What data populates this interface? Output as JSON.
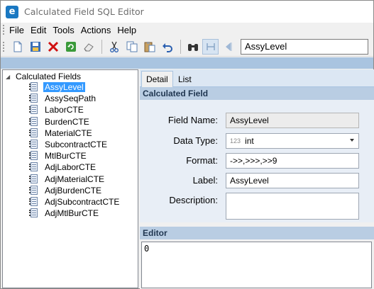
{
  "window": {
    "title": "Calculated Field SQL Editor",
    "app_icon_letter": "e"
  },
  "menu": [
    "File",
    "Edit",
    "Tools",
    "Actions",
    "Help"
  ],
  "toolbar": {
    "buttons": [
      "new-document-icon",
      "save-icon",
      "delete-icon",
      "refresh-icon",
      "eraser-icon",
      "cut-icon",
      "copy-icon",
      "paste-icon",
      "undo-icon",
      "binoculars-icon",
      "find-next-icon",
      "navigate-back-icon"
    ],
    "selected_field": "AssyLevel"
  },
  "tree": {
    "root_label": "Calculated Fields",
    "items": [
      "AssyLevel",
      "AssySeqPath",
      "LaborCTE",
      "BurdenCTE",
      "MaterialCTE",
      "SubcontractCTE",
      "MtlBurCTE",
      "AdjLaborCTE",
      "AdjMaterialCTE",
      "AdjBurdenCTE",
      "AdjSubcontractCTE",
      "AdjMtlBurCTE"
    ],
    "selected_index": 0
  },
  "tabs": [
    "Detail",
    "List"
  ],
  "detail": {
    "section_title": "Calculated Field",
    "field_name_label": "Field Name:",
    "field_name_value": "AssyLevel",
    "data_type_label": "Data Type:",
    "data_type_prefix": "123",
    "data_type_value": "int",
    "format_label": "Format:",
    "format_value": "->>,>>>,>>9",
    "label_label": "Label:",
    "label_value": "AssyLevel",
    "description_label": "Description:",
    "description_value": ""
  },
  "editor": {
    "section_title": "Editor",
    "content": "0"
  },
  "colors": {
    "band": "#a9c4e0",
    "selection": "#3399ff",
    "section_header": "#b9cde3",
    "app_icon": "#1a78c2"
  }
}
